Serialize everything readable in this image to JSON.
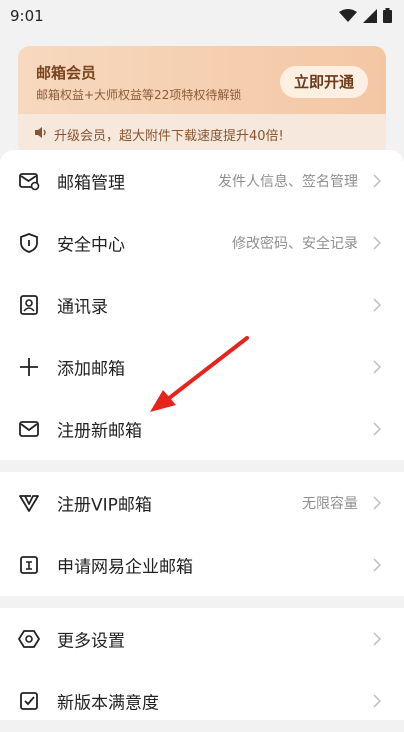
{
  "status_bar": {
    "time": "9:01"
  },
  "vip_card": {
    "title": "邮箱会员",
    "subtitle": "邮箱权益+大师权益等22项特权待解锁",
    "button": "立即开通",
    "promo": "升级会员，超大附件下载速度提升40倍!"
  },
  "menu_group1": [
    {
      "label": "邮箱管理",
      "detail": "发件人信息、签名管理",
      "icon": "mailbox-settings-icon"
    },
    {
      "label": "安全中心",
      "detail": "修改密码、安全记录",
      "icon": "shield-icon"
    },
    {
      "label": "通讯录",
      "detail": "",
      "icon": "contacts-icon"
    },
    {
      "label": "添加邮箱",
      "detail": "",
      "icon": "plus-icon"
    },
    {
      "label": "注册新邮箱",
      "detail": "",
      "icon": "envelope-icon"
    }
  ],
  "menu_group2": [
    {
      "label": "注册VIP邮箱",
      "detail": "无限容量",
      "icon": "vip-logo-icon"
    },
    {
      "label": "申请网易企业邮箱",
      "detail": "",
      "icon": "enterprise-mail-icon"
    }
  ],
  "menu_group3": [
    {
      "label": "更多设置",
      "detail": "",
      "icon": "hexagon-settings-icon"
    },
    {
      "label": "新版本满意度",
      "detail": "",
      "icon": "checkbox-icon"
    }
  ]
}
